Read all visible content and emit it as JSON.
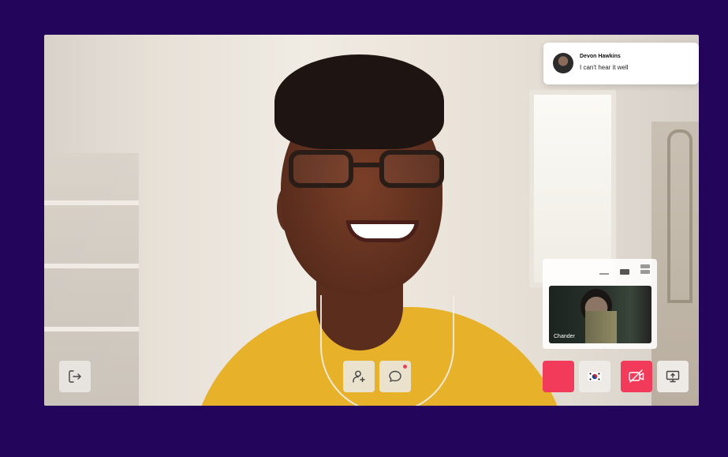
{
  "colors": {
    "background": "#24055c",
    "accent_red": "#f23a5a",
    "control_light": "#eeeae6",
    "shirt": "#e7b12a"
  },
  "notification": {
    "sender": "Devon Hawkins",
    "message": "I can't hear it well",
    "avatar_icon": "user-avatar"
  },
  "self_view": {
    "participant_name": "Chander",
    "layout_icons": [
      "minimize-icon",
      "single-view-icon",
      "split-view-icon"
    ]
  },
  "controls": {
    "left": [
      {
        "name": "leave-call-button",
        "icon": "exit-icon"
      }
    ],
    "center": [
      {
        "name": "add-participant-button",
        "icon": "add-user-icon"
      },
      {
        "name": "chat-button",
        "icon": "chat-bubble-icon",
        "has_unread": true
      }
    ],
    "right": [
      {
        "name": "record-button",
        "icon": "record-square"
      },
      {
        "name": "language-button",
        "icon": "south-korea-flag-icon"
      },
      {
        "name": "camera-toggle-button",
        "icon": "camera-off-icon"
      },
      {
        "name": "share-screen-button",
        "icon": "screen-share-icon"
      }
    ]
  }
}
